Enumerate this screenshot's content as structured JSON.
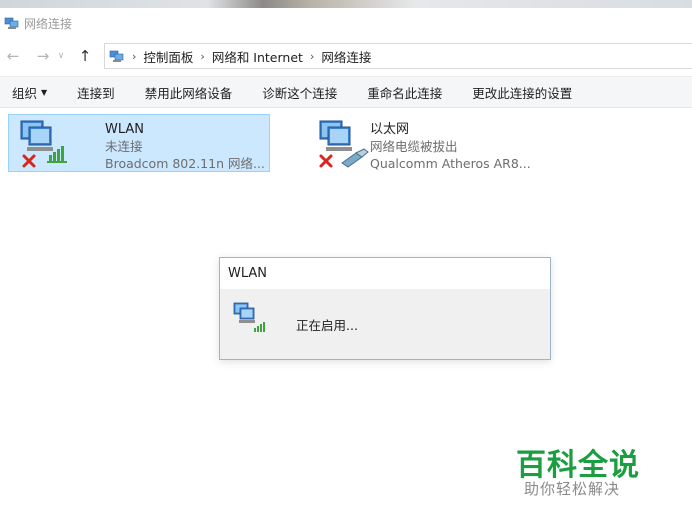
{
  "window": {
    "title": "网络连接"
  },
  "address": {
    "crumbs": [
      "控制面板",
      "网络和 Internet",
      "网络连接"
    ]
  },
  "commands": {
    "organize": "组织",
    "connect_to": "连接到",
    "disable_device": "禁用此网络设备",
    "diagnose": "诊断这个连接",
    "rename": "重命名此连接",
    "change_settings": "更改此连接的设置"
  },
  "adapters": [
    {
      "name": "WLAN",
      "status": "未连接",
      "device": "Broadcom 802.11n 网络..."
    },
    {
      "name": "以太网",
      "status": "网络电缆被拔出",
      "device": "Qualcomm Atheros AR8..."
    }
  ],
  "dialog": {
    "title": "WLAN",
    "message": "正在启用..."
  },
  "watermark": {
    "brand": "百科全说",
    "tagline": "助你轻松解决"
  },
  "colors": {
    "selection": "#cce8ff",
    "selection_border": "#99d1ff",
    "watermark_green": "#1a9e3f",
    "error_red": "#d9261c",
    "signal_green": "#3fa33f"
  }
}
